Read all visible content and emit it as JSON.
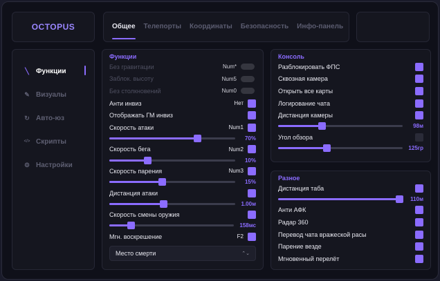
{
  "brand": "OCTOPUS",
  "tabs": [
    {
      "label": "Общее",
      "active": true
    },
    {
      "label": "Телепорты",
      "active": false
    },
    {
      "label": "Координаты",
      "active": false
    },
    {
      "label": "Безопасность",
      "active": false
    },
    {
      "label": "Инфо-панель",
      "active": false
    }
  ],
  "sidebar": [
    {
      "label": "Функции",
      "icon": "wand-icon",
      "active": true
    },
    {
      "label": "Визуалы",
      "icon": "brush-icon",
      "active": false
    },
    {
      "label": "Авто-юз",
      "icon": "refresh-icon",
      "active": false
    },
    {
      "label": "Скрипты",
      "icon": "code-icon",
      "active": false
    },
    {
      "label": "Настройки",
      "icon": "gear-icon",
      "active": false
    }
  ],
  "functions": {
    "title": "Функции",
    "rows": [
      {
        "label": "Без гравитации",
        "key": "Num*",
        "disabled": true
      },
      {
        "label": "Заблок. высоту",
        "key": "Num5",
        "disabled": true
      },
      {
        "label": "Без столкновений",
        "key": "Num0",
        "disabled": true
      },
      {
        "label": "Анти инвиз",
        "key": "Нет",
        "checked": true
      },
      {
        "label": "Отображать ГМ инвиз",
        "key": "",
        "checked": true
      },
      {
        "label": "Скорость атаки",
        "key": "Num1",
        "checked": true,
        "slider": {
          "value": "70%",
          "fill": 0.7
        }
      },
      {
        "label": "Скорость бега",
        "key": "Num2",
        "checked": true,
        "slider": {
          "value": "10%",
          "fill": 0.3
        }
      },
      {
        "label": "Скорость парения",
        "key": "Num3",
        "checked": true,
        "slider": {
          "value": "15%",
          "fill": 0.42
        }
      },
      {
        "label": "Дистанция атаки",
        "key": "",
        "checked": true,
        "slider": {
          "value": "1.00м",
          "fill": 0.43
        }
      },
      {
        "label": "Скорость смены оружия",
        "key": "",
        "checked": true,
        "slider": {
          "value": "158мс",
          "fill": 0.17
        }
      },
      {
        "label": "Мгн. воскрешение",
        "key": "F2",
        "checked": true
      }
    ],
    "select": "Место смерти"
  },
  "console": {
    "title": "Консоль",
    "rows": [
      {
        "label": "Разблокировать ФПС",
        "checked": true
      },
      {
        "label": "Сквозная камера",
        "checked": true
      },
      {
        "label": "Открыть все карты",
        "checked": true
      },
      {
        "label": "Логирование чата",
        "checked": true
      },
      {
        "label": "Дистанция камеры",
        "checked": true,
        "slider": {
          "value": "98м",
          "fill": 0.35
        }
      },
      {
        "label": "Угол обзора",
        "checked": false,
        "slider": {
          "value": "125гр",
          "fill": 0.39
        }
      }
    ]
  },
  "misc": {
    "title": "Разное",
    "rows": [
      {
        "label": "Дистанция таба",
        "checked": true,
        "slider": {
          "value": "110м",
          "fill": 0.97
        }
      },
      {
        "label": "Анти АФК",
        "checked": true
      },
      {
        "label": "Радар 360",
        "checked": true
      },
      {
        "label": "Перевод чата вражеской расы",
        "checked": true
      },
      {
        "label": "Парение везде",
        "checked": true
      },
      {
        "label": "Мгновенный перелёт",
        "checked": true
      }
    ]
  }
}
